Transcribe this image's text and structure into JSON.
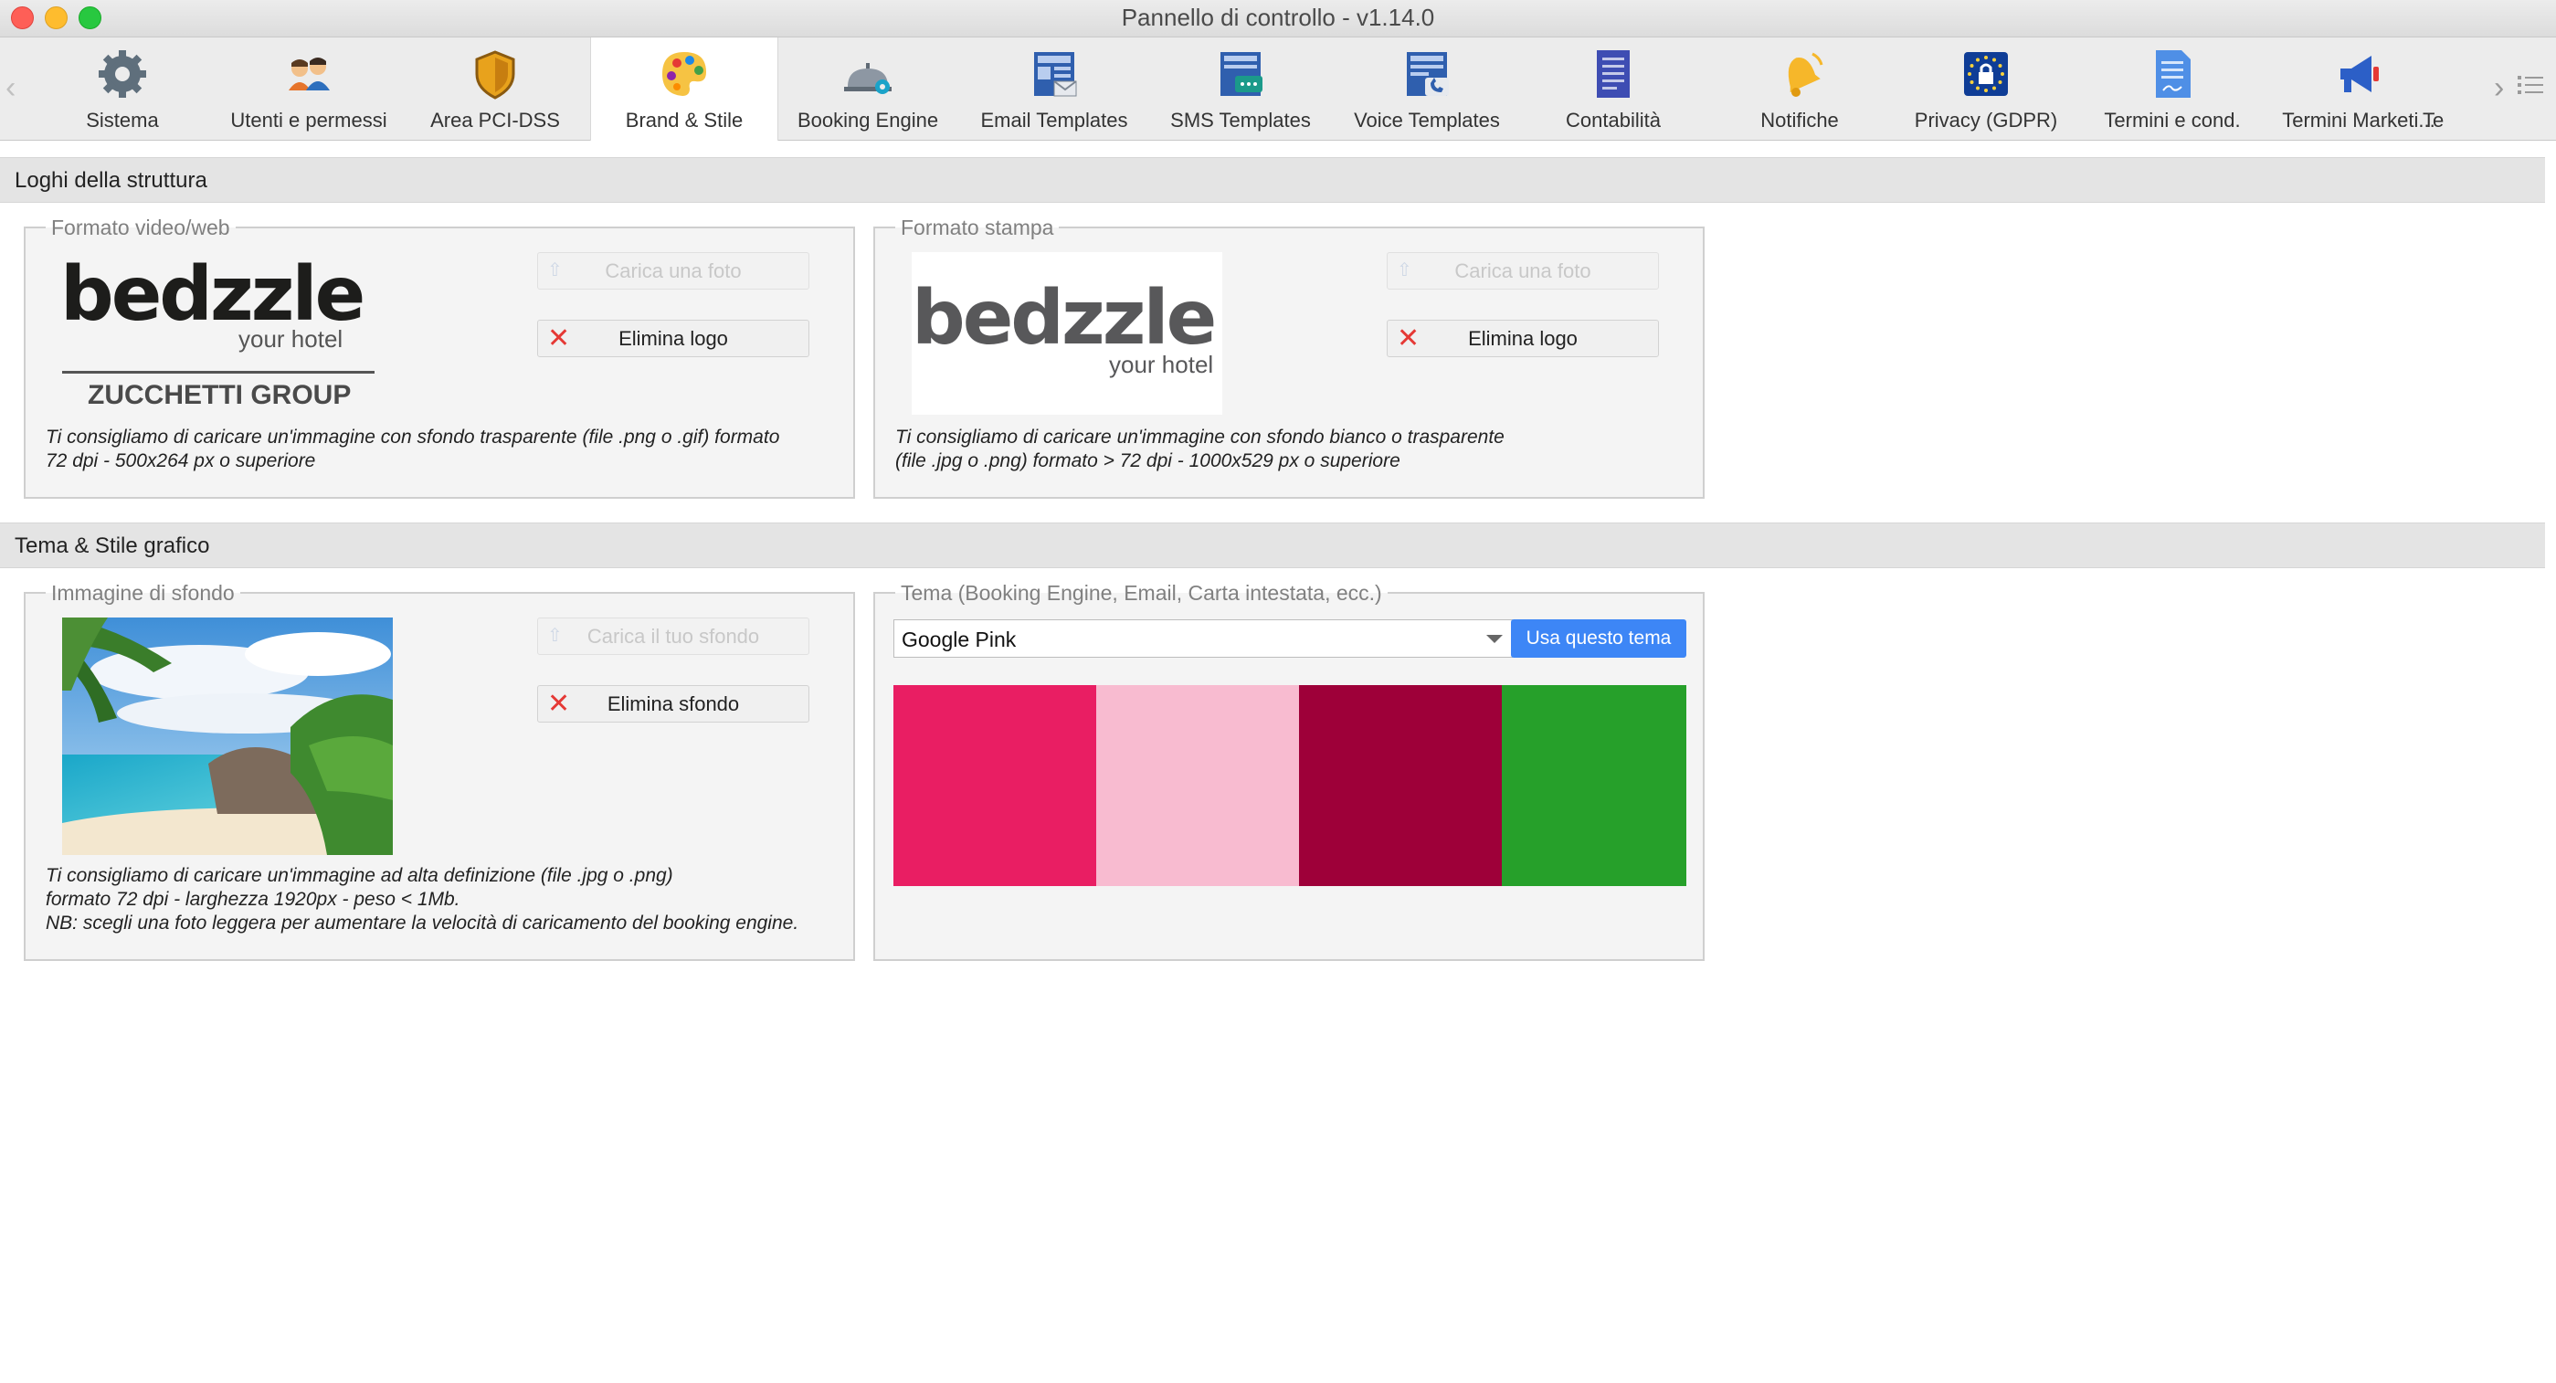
{
  "window": {
    "title": "Pannello di controllo - v1.14.0"
  },
  "toolbar": {
    "tabs": [
      {
        "label": "Sistema",
        "icon": "gear-icon"
      },
      {
        "label": "Utenti e permessi",
        "icon": "users-icon"
      },
      {
        "label": "Area PCI-DSS",
        "icon": "shield-icon"
      },
      {
        "label": "Brand & Stile",
        "icon": "palette-icon",
        "active": true
      },
      {
        "label": "Booking Engine",
        "icon": "bell-service-icon"
      },
      {
        "label": "Email Templates",
        "icon": "email-template-icon"
      },
      {
        "label": "SMS Templates",
        "icon": "sms-template-icon"
      },
      {
        "label": "Voice Templates",
        "icon": "voice-template-icon"
      },
      {
        "label": "Contabilità",
        "icon": "ledger-icon"
      },
      {
        "label": "Notifiche",
        "icon": "notification-bell-icon"
      },
      {
        "label": "Privacy (GDPR)",
        "icon": "gdpr-lock-icon"
      },
      {
        "label": "Termini e cond.",
        "icon": "document-sign-icon"
      },
      {
        "label": "Termini Marketi...",
        "icon": "megaphone-icon"
      },
      {
        "label": "Te",
        "icon": ""
      }
    ]
  },
  "section_logos": {
    "title": "Loghi della struttura",
    "web": {
      "legend": "Formato video/web",
      "logo_text": "bedzzle",
      "logo_sub": "your hotel",
      "logo_group": "ZUCCHETTI GROUP",
      "upload_label": "Carica una foto",
      "delete_label": "Elimina logo",
      "hint_line1": "Ti consigliamo di caricare un'immagine con sfondo trasparente (file .png o .gif) formato",
      "hint_line2": "72 dpi - 500x264 px o superiore"
    },
    "print": {
      "legend": "Formato stampa",
      "logo_text": "bedzzle",
      "logo_sub": "your hotel",
      "upload_label": "Carica una foto",
      "delete_label": "Elimina logo",
      "hint_line1": "Ti consigliamo di caricare un'immagine con sfondo bianco o trasparente",
      "hint_line2": "(file .jpg o .png) formato > 72 dpi - 1000x529 px o superiore"
    }
  },
  "section_theme": {
    "title": "Tema & Stile grafico",
    "background": {
      "legend": "Immagine di sfondo",
      "upload_label": "Carica il tuo sfondo",
      "delete_label": "Elimina sfondo",
      "hint_line1": "Ti consigliamo di caricare un'immagine ad alta definizione (file .jpg o .png)",
      "hint_line2": "formato 72 dpi - larghezza 1920px - peso < 1Mb.",
      "hint_line3": "NB: scegli una foto leggera per aumentare la velocità di caricamento del booking engine."
    },
    "theme": {
      "legend": "Tema (Booking Engine, Email, Carta intestata, ecc.)",
      "selected": "Google Pink",
      "apply_label": "Usa questo tema",
      "swatches": [
        "#e91e63",
        "#f8bbd0",
        "#9e0039",
        "#26a02a"
      ]
    }
  }
}
